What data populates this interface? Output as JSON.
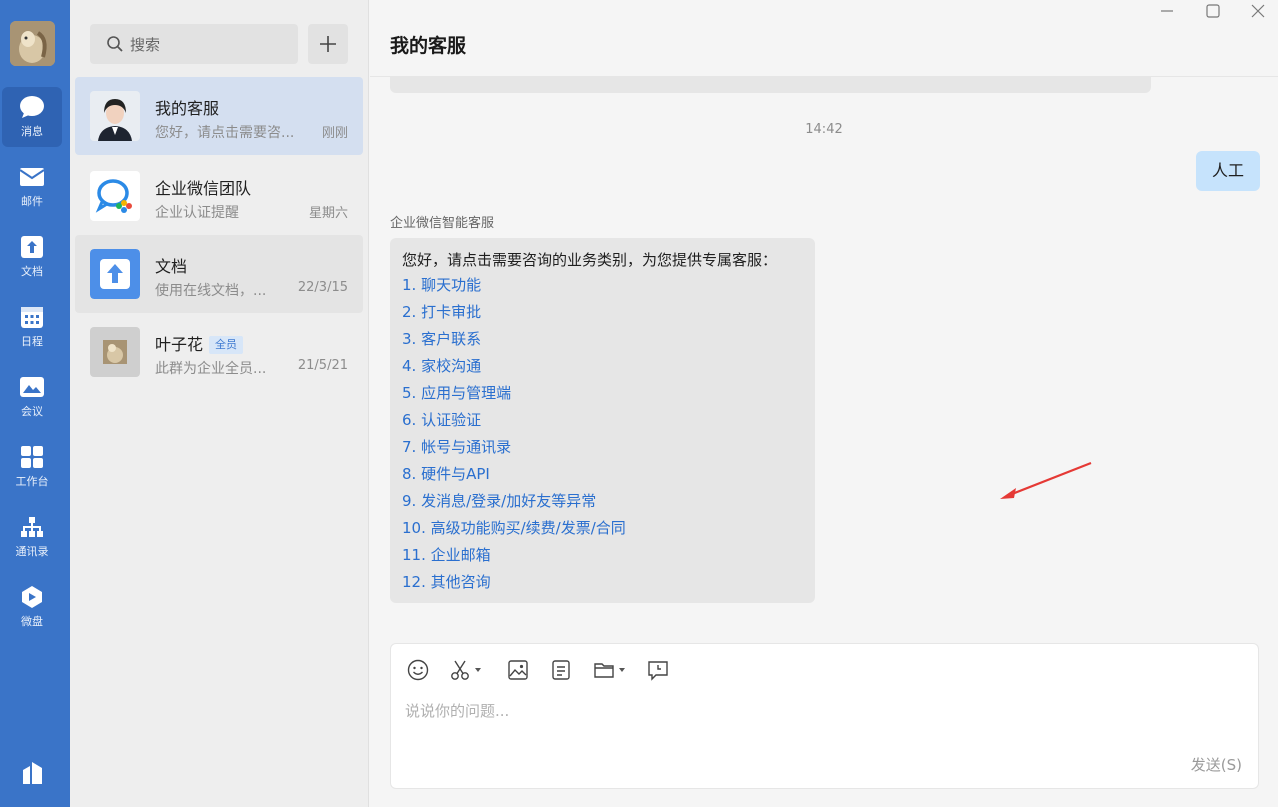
{
  "rail": {
    "items": [
      {
        "label": "消息",
        "icon": "chat-bubble-icon",
        "active": true
      },
      {
        "label": "邮件",
        "icon": "mail-icon"
      },
      {
        "label": "文档",
        "icon": "doc-icon"
      },
      {
        "label": "日程",
        "icon": "calendar-icon"
      },
      {
        "label": "会议",
        "icon": "meeting-icon"
      },
      {
        "label": "工作台",
        "icon": "workbench-grid-icon"
      },
      {
        "label": "通讯录",
        "icon": "contacts-tree-icon"
      },
      {
        "label": "微盘",
        "icon": "drive-icon"
      }
    ]
  },
  "list": {
    "search_placeholder": "搜索",
    "conversations": [
      {
        "name": "我的客服",
        "preview": "您好，请点击需要咨...",
        "time": "刚刚",
        "active": true
      },
      {
        "name": "企业微信团队",
        "preview": "企业认证提醒",
        "time": "星期六"
      },
      {
        "name": "文档",
        "preview": "使用在线文档，...",
        "time": "22/3/15"
      },
      {
        "name": "叶子花",
        "badge": "全员",
        "preview": "此群为企业全员...",
        "time": "21/5/21"
      }
    ]
  },
  "chat": {
    "title": "我的客服",
    "timestamp": "14:42",
    "my_message": "人工",
    "bot_sender": "企业微信智能客服",
    "bot_intro": "您好，请点击需要咨询的业务类别，为您提供专属客服：",
    "menu": [
      "1. 聊天功能",
      "2. 打卡审批",
      "3. 客户联系",
      "4. 家校沟通",
      "5. 应用与管理端",
      "6. 认证验证",
      "7. 帐号与通讯录",
      "8. 硬件与API",
      "9. 发消息/登录/加好友等异常",
      "10. 高级功能购买/续费/发票/合同",
      "11. 企业邮箱",
      "12. 其他咨询"
    ]
  },
  "composer": {
    "placeholder": "说说你的问题...",
    "send_label": "发送(S)"
  },
  "colors": {
    "rail": "#3a74c8",
    "link": "#2a6fcf",
    "my_bubble": "#c6e3fc",
    "annotation_arrow": "#e53935"
  }
}
